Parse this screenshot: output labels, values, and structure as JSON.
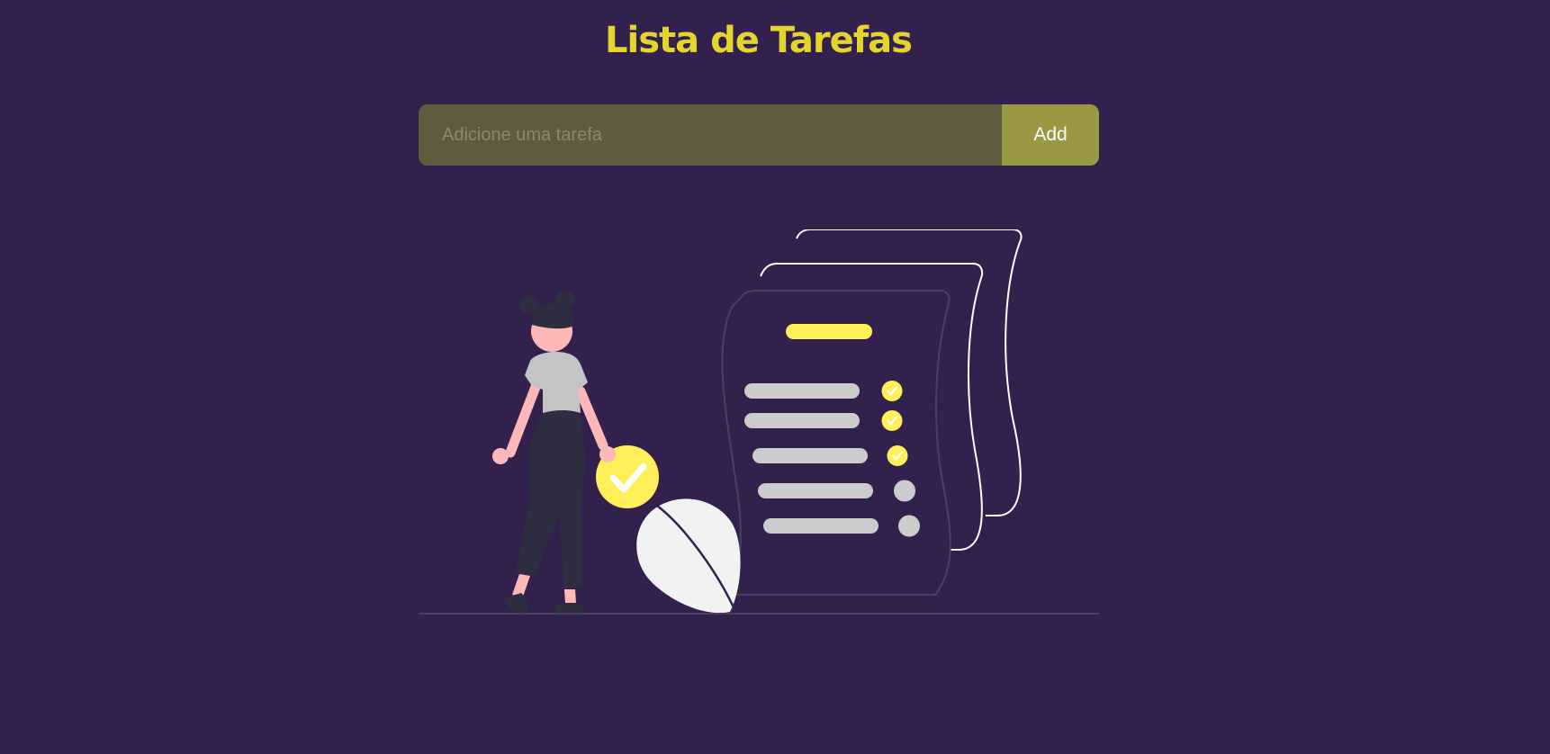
{
  "header": {
    "title": "Lista de Tarefas"
  },
  "form": {
    "placeholder": "Adicione uma tarefa",
    "value": "",
    "add_label": "Add"
  },
  "illustration": {
    "name": "empty-task-list-illustration",
    "checklist_items": [
      {
        "checked": true
      },
      {
        "checked": true
      },
      {
        "checked": true
      },
      {
        "checked": false
      },
      {
        "checked": false
      }
    ]
  },
  "colors": {
    "background": "#33214d",
    "accent": "#e3d52c",
    "input_bg": "#5e5b3e",
    "button_bg": "#9a9943",
    "check_yellow": "#fff05a"
  }
}
